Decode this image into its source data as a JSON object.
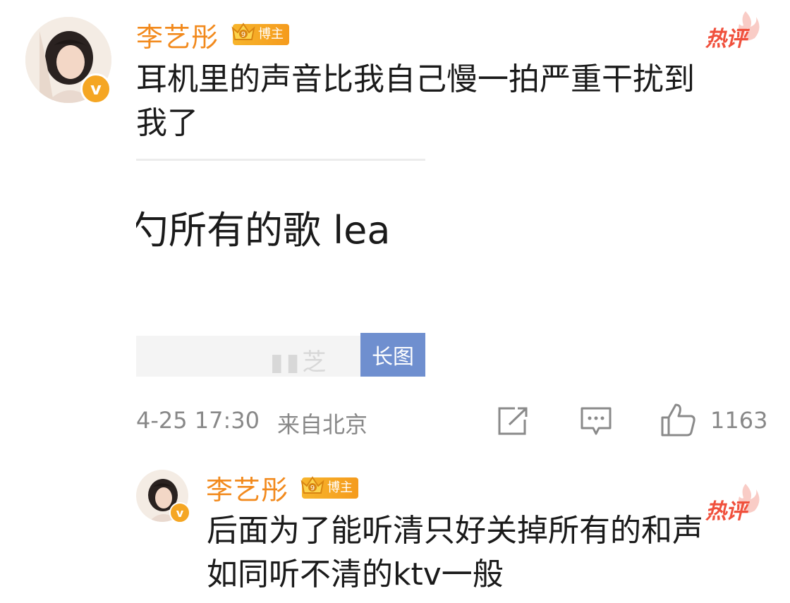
{
  "comment": {
    "username": "李艺彤",
    "badge": "博主",
    "hot_tag": "热评",
    "text_line1": "耳机里的声音比我自己慢一拍严重干扰到",
    "text_line2": "我了",
    "quote_image": {
      "visible_text": "勺所有的歌 lea",
      "long_image_label": "长图"
    },
    "timestamp": "4-25 17:30",
    "location": "来自北京",
    "like_count": "1163",
    "icons": [
      "share-icon",
      "comment-icon",
      "like-icon"
    ]
  },
  "reply": {
    "username": "李艺彤",
    "badge": "博主",
    "hot_tag": "热评",
    "text_line1": "后面为了能听清只好关掉所有的和声",
    "text_line2": "如同听不清的ktv一般"
  },
  "colors": {
    "username": "#f28a1d",
    "badge": "#f7b52c",
    "hot_tag": "#f0503c",
    "long_image_tag": "#6f8fcf",
    "meta_text": "#888888"
  }
}
